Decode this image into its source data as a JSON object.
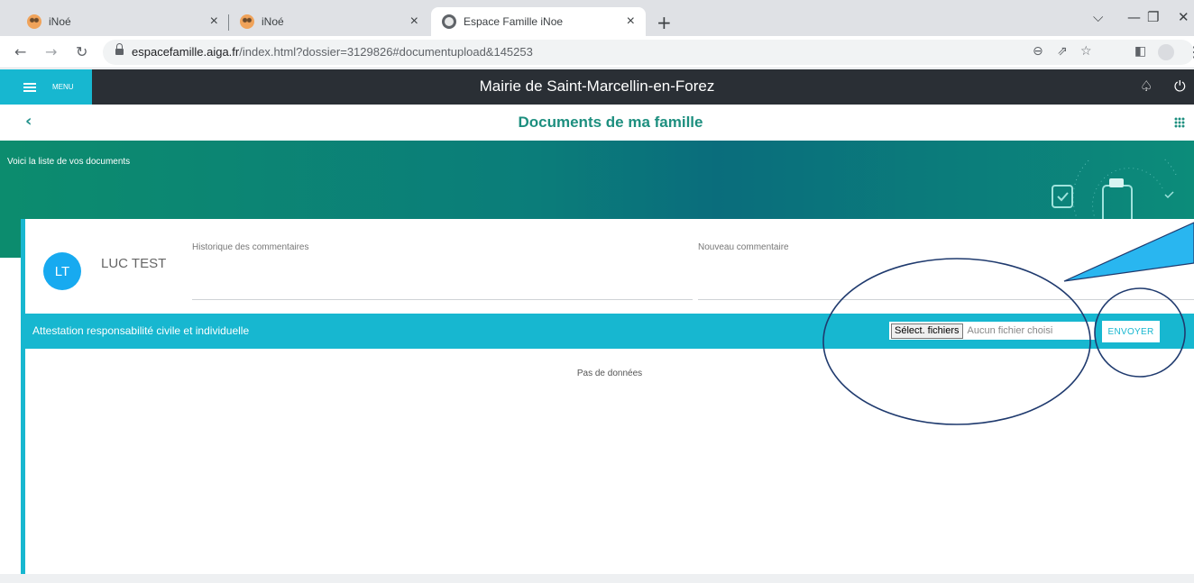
{
  "browser": {
    "tabs": [
      {
        "title": "iNoé",
        "favicon": "owl-icon"
      },
      {
        "title": "iNoé",
        "favicon": "owl-icon"
      },
      {
        "title": "Espace Famille iNoe",
        "favicon": "globe-icon",
        "active": true
      }
    ],
    "url_host": "espacefamille.aiga.fr",
    "url_path": "/index.html?dossier=3129826#documentupload&145253"
  },
  "header": {
    "menu_label": "MENU",
    "title": "Mairie de Saint-Marcellin-en-Forez"
  },
  "subheader": {
    "title": "Documents de ma famille"
  },
  "banner": {
    "text": "Voici la liste de vos documents"
  },
  "card": {
    "avatar_initials": "LT",
    "user_name": "LUC TEST",
    "history_label": "Historique des commentaires",
    "new_comment_label": "Nouveau commentaire",
    "document_title": "Attestation responsabilité civile et individuelle",
    "file_button_label": "Sélect. fichiers",
    "file_status": "Aucun fichier choisi",
    "send_label": "ENVOYER",
    "no_data": "Pas de données"
  },
  "colors": {
    "accent": "#17b7d0",
    "header_bg": "#2a2f35",
    "title_green": "#1d8f7f",
    "avatar": "#17aaf0",
    "annotation_ellipse": "#1f3a6e",
    "annotation_arrow": "#29b6f0"
  }
}
